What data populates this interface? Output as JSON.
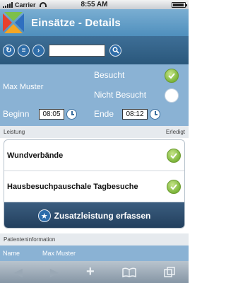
{
  "status_bar": {
    "carrier": "Carrier",
    "time": "8:55 AM",
    "battery_level": 0.85
  },
  "header": {
    "title": "Einsätze - Details"
  },
  "toolbar": {
    "search_value": ""
  },
  "patient": {
    "name": "Max Muster",
    "visited_label": "Besucht",
    "not_visited_label": "Nicht Besucht",
    "visited_selected": true,
    "start_label": "Beginn",
    "start_time": "08:05",
    "end_label": "Ende",
    "end_time": "08:12"
  },
  "services": {
    "header_left": "Leistung",
    "header_right": "Erledigt",
    "items": [
      {
        "label": "Wundverbände",
        "done": true
      },
      {
        "label": "Hausbesuchpauschale Tagbesuche",
        "done": true
      }
    ],
    "add_button_label": "Zusatzleistung erfassen"
  },
  "patient_info": {
    "header": "Patienteninformation",
    "name_key": "Name",
    "name_value": "Max Muster"
  },
  "colors": {
    "header": "#5f9ac6",
    "toolbar": "#2f5f85",
    "accent_check": "#7cb53a"
  }
}
